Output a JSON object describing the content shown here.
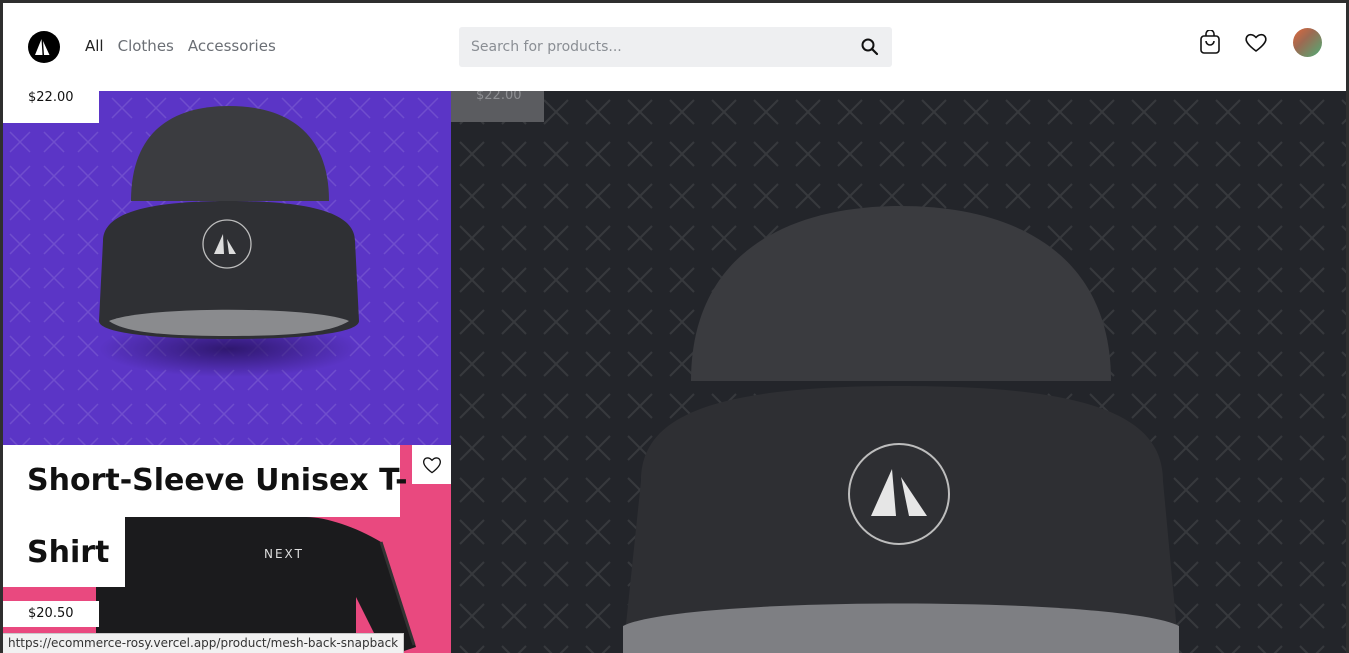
{
  "header": {
    "nav": [
      {
        "label": "All",
        "active": true
      },
      {
        "label": "Clothes",
        "active": false
      },
      {
        "label": "Accessories",
        "active": false
      }
    ],
    "search_placeholder": "Search for products...",
    "icons": [
      "logo-icon",
      "search-icon",
      "cart-icon",
      "heart-icon",
      "avatar"
    ]
  },
  "products": {
    "beanie_small": {
      "price": "$22.00",
      "logo_label": "brand-logo"
    },
    "tshirt": {
      "title_line1": "Short-Sleeve Unisex T-",
      "title_line2": "Shirt",
      "price": "$20.50",
      "shirt_text": "NEXT"
    },
    "beanie_large": {
      "price": "$22.00"
    }
  },
  "status_bar": {
    "url": "https://ecommerce-rosy.vercel.app/product/mesh-back-snapback"
  },
  "colors": {
    "purple": "#5b35c6",
    "pink": "#e9497f",
    "dark": "#23252a"
  }
}
